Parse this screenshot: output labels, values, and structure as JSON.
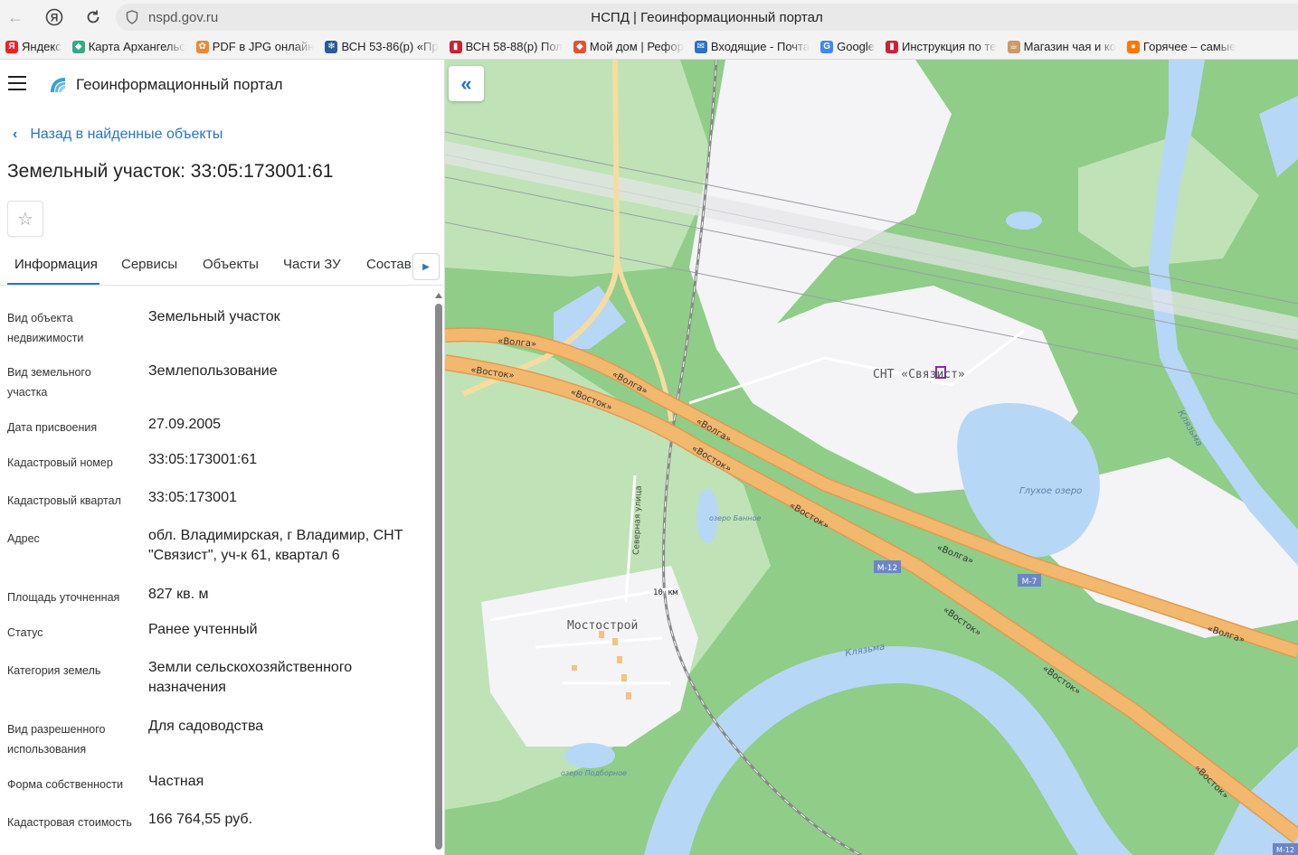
{
  "browser": {
    "url": "nspd.gov.ru",
    "tab_title": "НСПД | Геоинформационный портал",
    "bookmarks": [
      {
        "label": "Яндекс",
        "icon": "yandex-icon",
        "color": "#e22"
      },
      {
        "label": "Карта Архангельс",
        "icon": "map-icon",
        "color": "#3a8"
      },
      {
        "label": "PDF в JPG онлайн",
        "icon": "pdf-icon",
        "color": "#e83"
      },
      {
        "label": "ВСН 53-86(р) «Пр",
        "icon": "snowflake-icon",
        "color": "#2a5a9a"
      },
      {
        "label": "ВСН 58-88(р) Пол",
        "icon": "doc-icon",
        "color": "#c23"
      },
      {
        "label": "Мой дом | Рефор",
        "icon": "house-icon",
        "color": "#d53"
      },
      {
        "label": "Входящие - Почта",
        "icon": "mail-icon",
        "color": "#2a73c7"
      },
      {
        "label": "Google",
        "icon": "google-icon",
        "color": "#4285f4"
      },
      {
        "label": "Инструкция по те",
        "icon": "doc-icon",
        "color": "#c23"
      },
      {
        "label": "Магазин чая и ко",
        "icon": "tea-icon",
        "color": "#c96"
      },
      {
        "label": "Горячее – самые",
        "icon": "fire-icon",
        "color": "#f70"
      }
    ]
  },
  "app": {
    "portal_name": "Геоинформационный портал",
    "back_label": "Назад в найденные объекты",
    "object_title": "Земельный участок: 33:05:173001:61",
    "tabs": [
      "Информация",
      "Сервисы",
      "Объекты",
      "Части ЗУ",
      "Состав"
    ],
    "active_tab": "Информация"
  },
  "info": [
    {
      "label": "Вид объекта недвижимости",
      "value": "Земельный участок"
    },
    {
      "label": "Вид земельного участка",
      "value": "Землепользование"
    },
    {
      "label": "Дата присвоения",
      "value": "27.09.2005"
    },
    {
      "label": "Кадастровый номер",
      "value": "33:05:173001:61"
    },
    {
      "label": "Кадастровый квартал",
      "value": "33:05:173001"
    },
    {
      "label": "Адрес",
      "value": "обл. Владимирская, г Владимир, СНТ \"Связист\", уч-к 61, квартал 6"
    },
    {
      "label": "Площадь уточненная",
      "value": "827 кв. м"
    },
    {
      "label": "Статус",
      "value": "Ранее учтенный"
    },
    {
      "label": "Категория земель",
      "value": "Земли сельскохозяйственного назначения"
    },
    {
      "label": "Вид разрешенного использования",
      "value": "Для садоводства"
    },
    {
      "label": "Форма собственности",
      "value": "Частная"
    },
    {
      "label": "Кадастровая стоимость",
      "value": "166 764,55 руб."
    }
  ],
  "map": {
    "labels": {
      "snt": "СНТ «Связист»",
      "mostostroy": "Мостострой",
      "glukhoe": "Глухое озеро",
      "ozero_bankoe": "озеро Банное",
      "ozero_podbornoe": "озеро Подборное",
      "klyazma": "Клязьма",
      "severnaya": "Северная улица",
      "km10": "10 км",
      "volga": "«Волга»",
      "vostok": "«Восток»",
      "m12": "М-12",
      "m7": "М-7"
    },
    "colors": {
      "forest": "#8fcd88",
      "field": "#f4f3f6",
      "water": "#b7d7f6",
      "road": "#f2b86e",
      "road_light": "#f7dca0"
    }
  }
}
